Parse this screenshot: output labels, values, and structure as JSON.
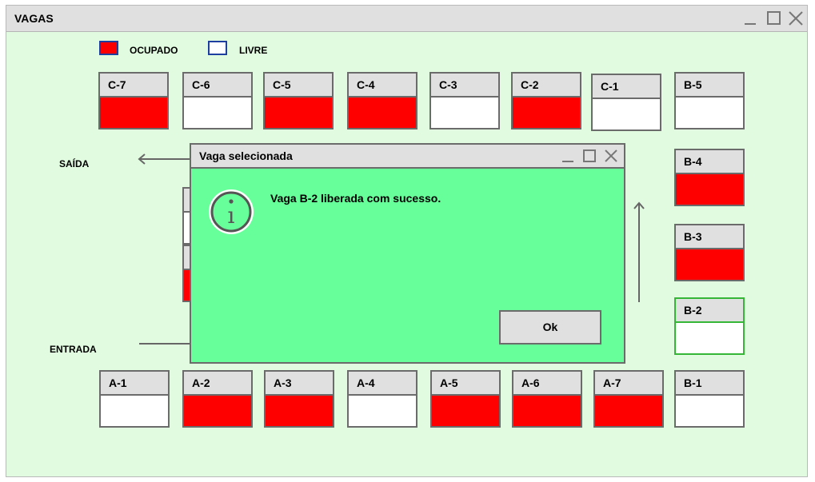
{
  "window": {
    "title": "VAGAS"
  },
  "legend": {
    "occupied": {
      "label": "OCUPADO",
      "color": "#ff0000"
    },
    "free": {
      "label": "LIVRE",
      "color": "#ffffff"
    }
  },
  "labels": {
    "exit": "SAÍDA",
    "entry": "ENTRADA"
  },
  "spots": {
    "C-7": {
      "label": "C-7",
      "status": "occupied"
    },
    "C-6": {
      "label": "C-6",
      "status": "free"
    },
    "C-5": {
      "label": "C-5",
      "status": "occupied"
    },
    "C-4": {
      "label": "C-4",
      "status": "occupied"
    },
    "C-3": {
      "label": "C-3",
      "status": "free"
    },
    "C-2": {
      "label": "C-2",
      "status": "occupied"
    },
    "C-1": {
      "label": "C-1",
      "status": "free"
    },
    "B-5": {
      "label": "B-5",
      "status": "free"
    },
    "B-4": {
      "label": "B-4",
      "status": "occupied"
    },
    "B-3": {
      "label": "B-3",
      "status": "occupied"
    },
    "B-2": {
      "label": "B-2",
      "status": "free"
    },
    "B-1": {
      "label": "B-1",
      "status": "free"
    },
    "A-1": {
      "label": "A-1",
      "status": "free"
    },
    "A-2": {
      "label": "A-2",
      "status": "occupied"
    },
    "A-3": {
      "label": "A-3",
      "status": "occupied"
    },
    "A-4": {
      "label": "A-4",
      "status": "free"
    },
    "A-5": {
      "label": "A-5",
      "status": "occupied"
    },
    "A-6": {
      "label": "A-6",
      "status": "occupied"
    },
    "A-7": {
      "label": "A-7",
      "status": "occupied"
    }
  },
  "dialog": {
    "title": "Vaga selecionada",
    "message": "Vaga B-2 liberada com sucesso.",
    "ok_label": "Ok",
    "icon": "info-icon"
  },
  "colors": {
    "background": "#e0fbe0",
    "dialog": "#66ff99",
    "selected_border": "#36b636"
  }
}
